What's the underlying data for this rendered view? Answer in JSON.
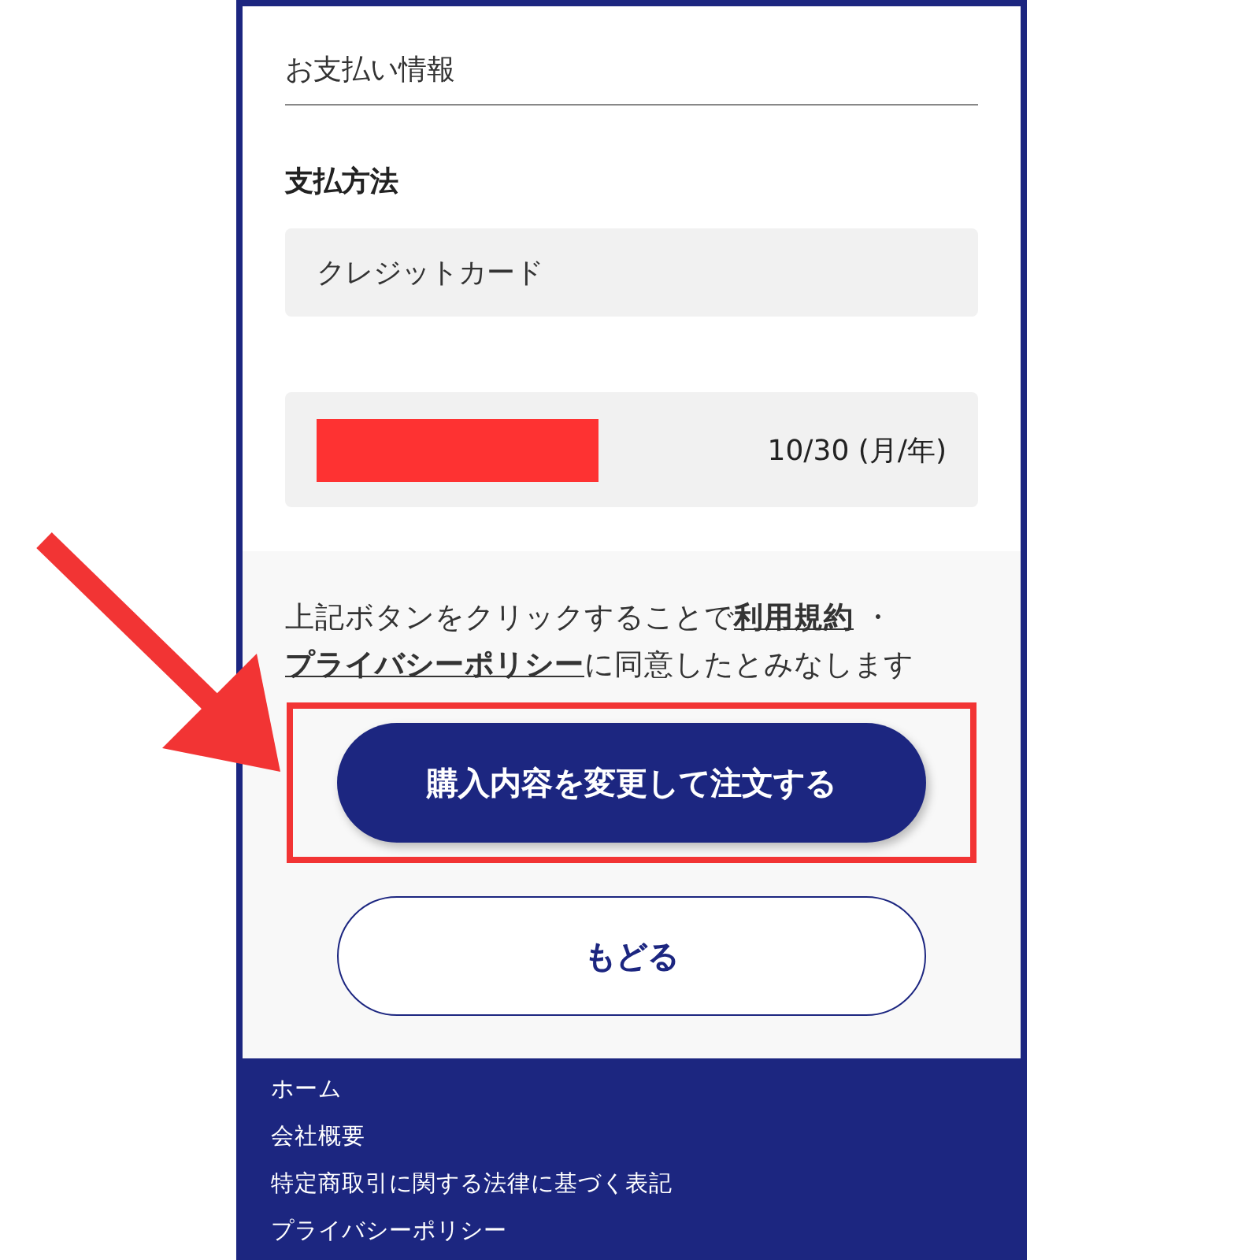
{
  "section": {
    "title": "お支払い情報"
  },
  "payment_method": {
    "label": "支払方法",
    "value": "クレジットカード"
  },
  "card": {
    "expiry": "10/30 (月/年)"
  },
  "notice": [
    {
      "kind": "plain",
      "text": "上記ボタンをクリックすることで"
    },
    {
      "kind": "link",
      "text": "利用規約"
    },
    {
      "kind": "plain",
      "text": " ・"
    },
    {
      "kind": "link",
      "text": "プライバシーポリシー"
    },
    {
      "kind": "plain",
      "text": "に同意したとみなします"
    }
  ],
  "buttons": [
    {
      "kind": "primary",
      "label": "購入内容を変更して注文する",
      "highlighted": true
    },
    {
      "kind": "secondary",
      "label": "もどる",
      "highlighted": false
    }
  ],
  "footer": {
    "links": [
      "ホーム",
      "会社概要",
      "特定商取引に関する法律に基づく表記",
      "プライバシーポリシー"
    ]
  }
}
